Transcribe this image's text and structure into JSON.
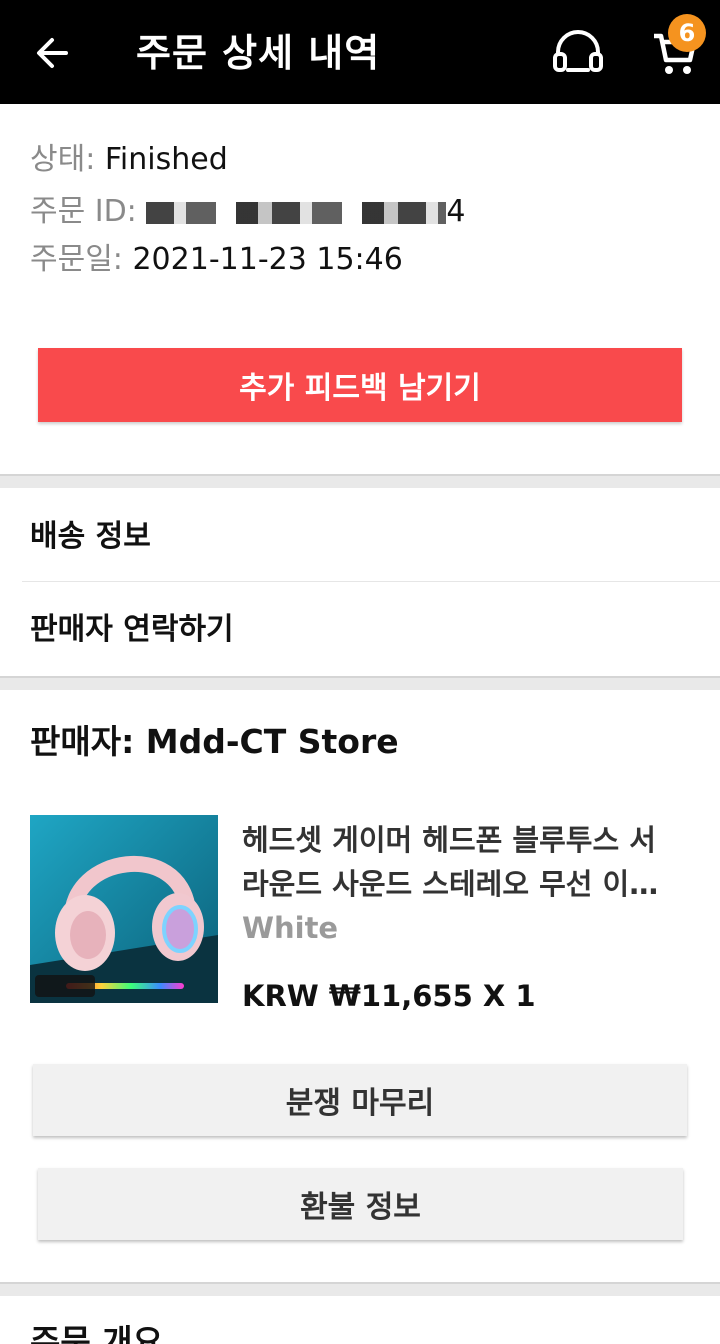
{
  "header": {
    "title": "주문 상세 내역",
    "cart_count": "6"
  },
  "order": {
    "status_label": "상태:",
    "status_value": "Finished",
    "id_label": "주문 ID:",
    "id_suffix": "4",
    "date_label": "주문일:",
    "date_value": "2021-11-23 15:46",
    "feedback_button": "추가 피드백 남기기"
  },
  "links": {
    "shipping": "배송 정보",
    "contact_seller": "판매자 연락하기"
  },
  "seller": {
    "title": "판매자: Mdd-CT Store"
  },
  "product": {
    "name": "헤드셋 게이머 헤드폰 블루투스 서라운드 사운드 스테레오 무선 이어폰",
    "variant": "White",
    "price": "KRW ₩11,655 X 1"
  },
  "actions": {
    "close_dispute": "분쟁 마무리",
    "refund_info": "환불 정보"
  },
  "summary": {
    "heading": "주문 개요"
  },
  "colors": {
    "accent": "#f94a4c",
    "badge": "#f5931f",
    "header_bg": "#000000"
  }
}
